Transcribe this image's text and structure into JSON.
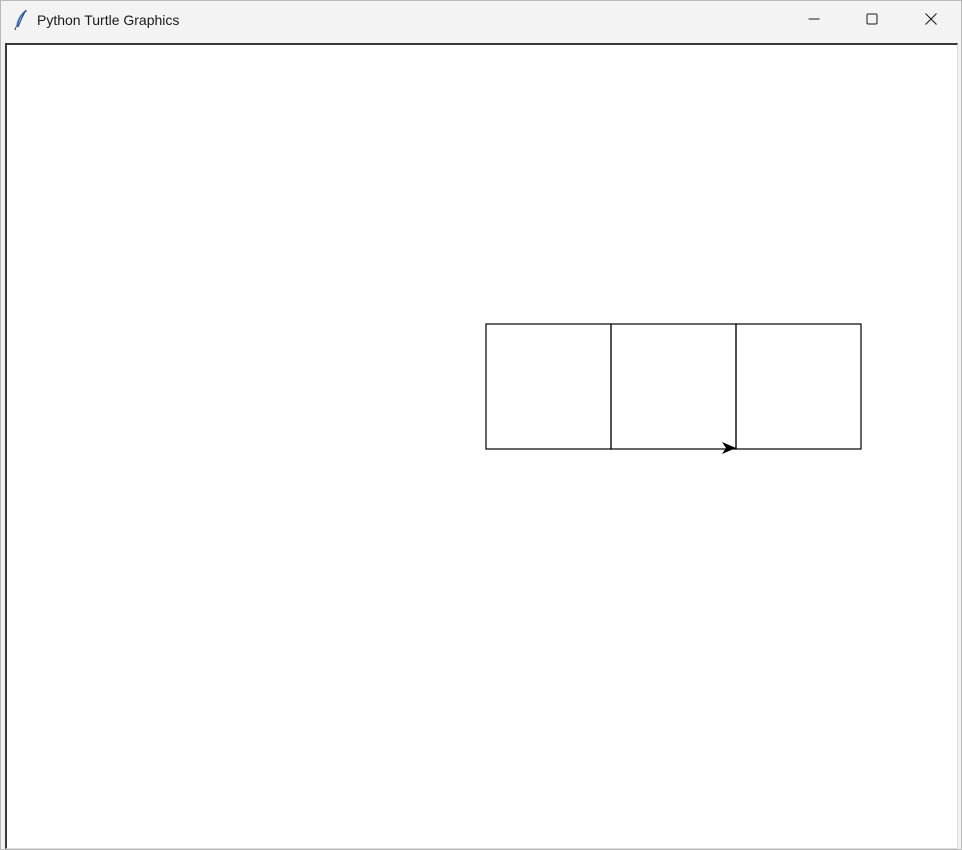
{
  "window": {
    "title": "Python Turtle Graphics",
    "app_icon": "feather-icon",
    "controls": [
      "minimize-icon",
      "maximize-icon",
      "close-icon"
    ]
  },
  "canvas": {
    "background": "#ffffff",
    "pen_color": "#000000",
    "drawing": {
      "shape": "square",
      "count": 3,
      "side_length": 125
    },
    "turtle": {
      "shape": "classic-arrow",
      "heading": "east"
    }
  }
}
